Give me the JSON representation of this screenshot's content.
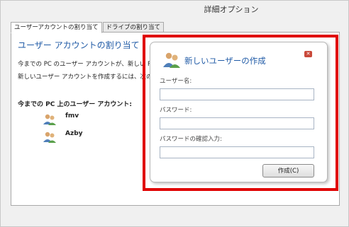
{
  "window": {
    "title": "詳細オプション"
  },
  "tabs": [
    {
      "label": "ユーザーアカウントの割り当て",
      "active": true
    },
    {
      "label": "ドライブの割り当て",
      "active": false
    }
  ],
  "panel": {
    "title": "ユーザー アカウントの割り当て",
    "line1": "今までの PC のユーザー アカウントが、新しい PC",
    "line2": "新しいユーザー アカウントを作成するには、次の",
    "accounts_heading": "今までの PC 上のユーザー アカウント:",
    "accounts": [
      {
        "name": "fmv"
      },
      {
        "name": "Azby"
      }
    ]
  },
  "dialog": {
    "title": "新しいユーザーの作成",
    "username_label": "ユーザー名:",
    "username_value": "",
    "password_label": "パスワード:",
    "password_value": "",
    "confirm_label": "パスワードの確認入力:",
    "confirm_value": "",
    "create_button": "作成(C)",
    "highlight_color": "#e00000"
  }
}
